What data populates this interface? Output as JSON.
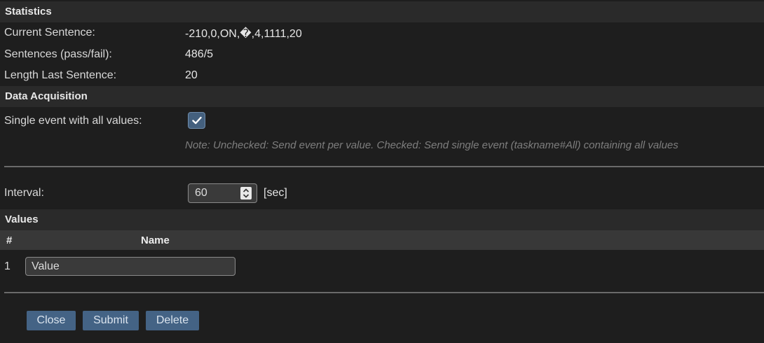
{
  "statistics": {
    "header": "Statistics",
    "rows": [
      {
        "label": "Current Sentence:",
        "value": "-210,0,ON,�,4,1111,20"
      },
      {
        "label": "Sentences (pass/fail):",
        "value": "486/5"
      },
      {
        "label": "Length Last Sentence:",
        "value": "20"
      }
    ]
  },
  "acquisition": {
    "header": "Data Acquisition",
    "single_event_label": "Single event with all values:",
    "single_event_checked": true,
    "note": "Note: Unchecked: Send event per value. Checked: Send single event (taskname#All) containing all values",
    "interval_label": "Interval:",
    "interval_value": "60",
    "interval_unit": "[sec]"
  },
  "values": {
    "header": "Values",
    "columns": [
      "#",
      "Name"
    ],
    "rows": [
      {
        "index": "1",
        "name": "Value"
      }
    ]
  },
  "buttons": {
    "close": "Close",
    "submit": "Submit",
    "delete": "Delete"
  },
  "colors": {
    "background": "#1e1e1e",
    "section_header": "#2a2a2a",
    "table_header": "#383838",
    "button": "#446385",
    "checkbox": "#44607e",
    "note_text": "#7e7e7e"
  },
  "icons": {
    "checkbox_mark": "check-icon",
    "spinner": "spin-updown-icon"
  }
}
